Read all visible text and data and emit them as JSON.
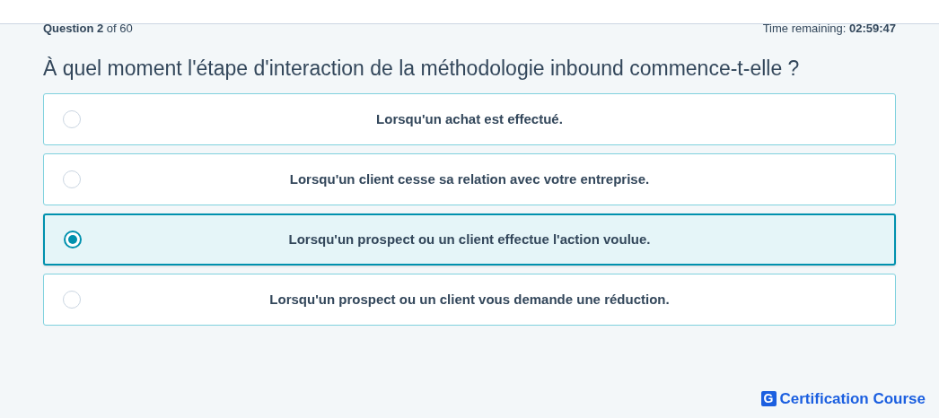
{
  "progress": "**Question 2** of 60",
  "timer": "Time remaining: **02:59:47**",
  "question": "À quel moment l'étape d'interaction de la méthodologie inbound commence-t-elle ?",
  "options": [
    {
      "label": "Lorsqu'un achat est effectué.",
      "selected": false
    },
    {
      "label": "Lorsqu'un client cesse sa relation avec votre entreprise.",
      "selected": false
    },
    {
      "label": "Lorsqu'un prospect ou un client effectue l'action voulue.",
      "selected": true
    },
    {
      "label": "Lorsqu'un prospect ou un client vous demande une réduction.",
      "selected": false
    }
  ],
  "brand": {
    "letter": "G",
    "name": "Certification Course"
  }
}
